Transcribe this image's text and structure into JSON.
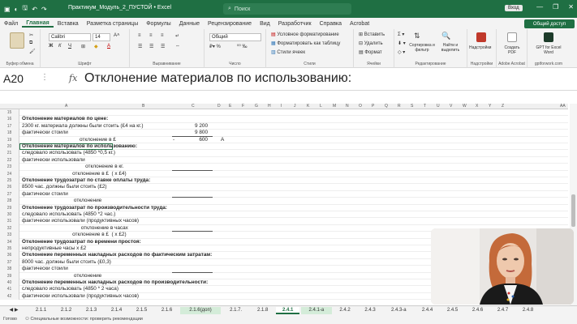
{
  "titlebar": {
    "title": "Практикум_Модуль_2_ПУСТОЙ  •  Excel",
    "search_placeholder": "Поиск",
    "signin": "Вход",
    "accent": "#1f6f43"
  },
  "tabs": [
    "Файл",
    "Главная",
    "Вставка",
    "Разметка страницы",
    "Формулы",
    "Данные",
    "Рецензирование",
    "Вид",
    "Разработчик",
    "Справка",
    "Acrobat"
  ],
  "active_tab": "Главная",
  "share_label": "Общий доступ",
  "ribbon": {
    "clipboard_label": "Буфер обмена",
    "font_label": "Шрифт",
    "font_name": "Calibri",
    "font_size": "14",
    "align_label": "Выравнивание",
    "number_label": "Число",
    "number_format": "Общий",
    "styles_label": "Стили",
    "cond_format": "Условное форматирование",
    "format_table": "Форматировать как таблицу",
    "cell_styles": "Стили ячеек",
    "cells_label": "Ячейки",
    "insert": "Вставить",
    "delete": "Удалить",
    "format": "Формат",
    "editing_label": "Редактирование",
    "sort_filter": "Сортировка и фильтр",
    "find_select": "Найти и выделить",
    "addins": "Надстройки",
    "addins_label": "Надстройки",
    "create_pdf": "Создать PDF",
    "acrobat_label": "Adobe Acrobat",
    "gpt": "GPT for Excel Word",
    "gpt_label": "gptforwork.com"
  },
  "formula_bar": {
    "name_box": "A20",
    "fx": "fx",
    "formula": "Отклонение материалов по использованию:"
  },
  "columns": [
    "A",
    "B",
    "C",
    "D",
    "E",
    "F",
    "G",
    "H",
    "I",
    "J",
    "K",
    "L",
    "M",
    "N",
    "O",
    "P",
    "Q",
    "R",
    "S",
    "T",
    "U",
    "V",
    "W",
    "X",
    "Y",
    "Z",
    "AA"
  ],
  "rows": [
    {
      "n": "15",
      "a": "",
      "bold": false,
      "c": "",
      "d": "",
      "dash": "",
      "line": false
    },
    {
      "n": "16",
      "a": "Отклонение материалов по цене:",
      "bold": true,
      "c": "",
      "d": "",
      "dash": "",
      "line": false
    },
    {
      "n": "17",
      "a": "2300 кг. материала должны были стоить (£4 на кг.)",
      "bold": false,
      "c": "9 200",
      "d": "",
      "dash": "",
      "line": false
    },
    {
      "n": "18",
      "a": "фактически стоили",
      "bold": false,
      "c": "9 800",
      "d": "",
      "dash": "",
      "line": true
    },
    {
      "n": "19",
      "a": "                                        отклонение в £",
      "bold": false,
      "c": "600",
      "d": "A",
      "dash": "-",
      "line": false
    },
    {
      "n": "20",
      "a": "Отклонение материалов по использованию:",
      "bold": true,
      "c": "",
      "d": "",
      "dash": "",
      "line": false
    },
    {
      "n": "21",
      "a": "следовало использовать (4850 *0,5 кг.)",
      "bold": false,
      "c": "",
      "d": "",
      "dash": "",
      "line": false
    },
    {
      "n": "22",
      "a": "фактически использовали",
      "bold": false,
      "c": "",
      "d": "",
      "dash": "",
      "line": false
    },
    {
      "n": "23",
      "a": "                                            отклонение в кг.",
      "bold": false,
      "c": "",
      "d": "",
      "dash": "",
      "line": true
    },
    {
      "n": "24",
      "a": "                                   отклонение в £  ( х £4)",
      "bold": false,
      "c": "",
      "d": "",
      "dash": "",
      "line": false
    },
    {
      "n": "25",
      "a": "Отклонение трудозатрат по ставке оплаты труда:",
      "bold": true,
      "c": "",
      "d": "",
      "dash": "",
      "line": false
    },
    {
      "n": "26",
      "a": "8500 час. должны были стоить (£2)",
      "bold": false,
      "c": "",
      "d": "",
      "dash": "",
      "line": false
    },
    {
      "n": "27",
      "a": "фактически стоили",
      "bold": false,
      "c": "",
      "d": "",
      "dash": "",
      "line": true
    },
    {
      "n": "28",
      "a": "                                    отклонение",
      "bold": false,
      "c": "",
      "d": "",
      "dash": "",
      "line": false
    },
    {
      "n": "29",
      "a": "Отклонение трудозатрат по производительности труда:",
      "bold": true,
      "c": "",
      "d": "",
      "dash": "",
      "line": false
    },
    {
      "n": "30",
      "a": "следовало использовать (4850 *2 час.)",
      "bold": false,
      "c": "",
      "d": "",
      "dash": "",
      "line": false
    },
    {
      "n": "31",
      "a": "фактически использовали (продуктивных часов)",
      "bold": false,
      "c": "",
      "d": "",
      "dash": "",
      "line": false
    },
    {
      "n": "32",
      "a": "                                         отклонение в часах",
      "bold": false,
      "c": "",
      "d": "",
      "dash": "",
      "line": true
    },
    {
      "n": "33",
      "a": "                                   отклонение в £  ( х £2)",
      "bold": false,
      "c": "",
      "d": "",
      "dash": "",
      "line": false
    },
    {
      "n": "34",
      "a": "Отклонение трудозатрат по времени простоя:",
      "bold": true,
      "c": "",
      "d": "",
      "dash": "",
      "line": false
    },
    {
      "n": "35",
      "a": "непродуктивные часы х £2",
      "bold": false,
      "c": "",
      "d": "",
      "dash": "",
      "line": false
    },
    {
      "n": "36",
      "a": "Отклонение переменных накладных расходов по фактическим затратам:",
      "bold": true,
      "c": "",
      "d": "",
      "dash": "",
      "line": false
    },
    {
      "n": "37",
      "a": "8000 час. должны были стоить (£0,3)",
      "bold": false,
      "c": "",
      "d": "",
      "dash": "",
      "line": false
    },
    {
      "n": "38",
      "a": "фактически стоили",
      "bold": false,
      "c": "",
      "d": "",
      "dash": "",
      "line": true
    },
    {
      "n": "39",
      "a": "                                    отклонение",
      "bold": false,
      "c": "",
      "d": "",
      "dash": "",
      "line": false
    },
    {
      "n": "40",
      "a": "Отклонение переменных накладных расходов по производительности:",
      "bold": true,
      "c": "",
      "d": "",
      "dash": "",
      "line": false
    },
    {
      "n": "41",
      "a": "следовало использовать (4850 * 2 часа)",
      "bold": false,
      "c": "",
      "d": "",
      "dash": "",
      "line": false
    },
    {
      "n": "42",
      "a": "фактически использовали (продуктивных часов)",
      "bold": false,
      "c": "",
      "d": "",
      "dash": "",
      "line": false
    }
  ],
  "sheet_tabs": [
    "2.1.1",
    "2.1.2",
    "2.1.3",
    "2.1.4",
    "2.1.5",
    "2.1.6",
    "2.1.6(доп)",
    "2.1.7.",
    "2.1.8",
    "2.4.1",
    "2.4.1-a",
    "2.4.2",
    "2.4.3",
    "2.4.3-a",
    "2.4.4",
    "2.4.5",
    "2.4.6",
    "2.4.7",
    "2.4.8"
  ],
  "active_sheet": "2.4.1",
  "green_sheets": [
    "2.1.6(доп)",
    "2.4.1-a"
  ],
  "status": {
    "ready": "Готово",
    "accessibility": "Специальные возможности: проверить рекомендации"
  }
}
